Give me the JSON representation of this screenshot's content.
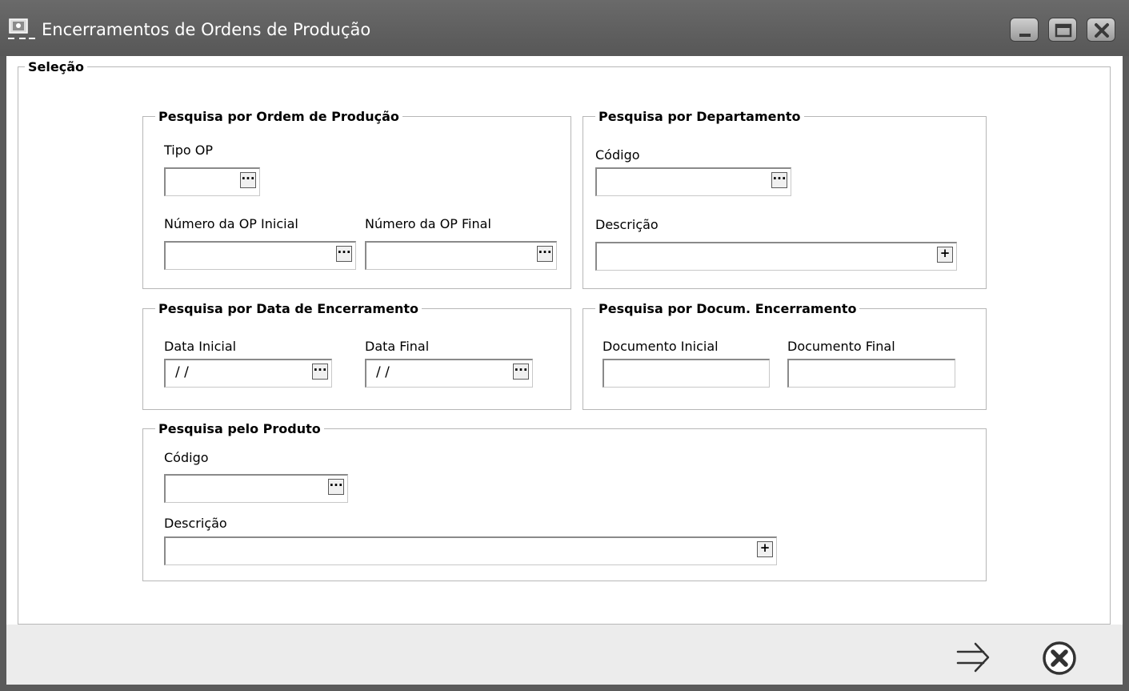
{
  "window": {
    "title": "Encerramentos de Ordens de Produção",
    "icon": "app-icon"
  },
  "selecao": {
    "legend": "Seleção"
  },
  "ordem": {
    "legend": "Pesquisa por Ordem de Produção",
    "tipo_label": "Tipo OP",
    "tipo_value": "",
    "inicial_label": "Número da OP Inicial",
    "inicial_value": "",
    "final_label": "Número da OP Final",
    "final_value": ""
  },
  "departamento": {
    "legend": "Pesquisa por Departamento",
    "codigo_label": "Código",
    "codigo_value": "",
    "descricao_label": "Descrição",
    "descricao_value": ""
  },
  "data_enc": {
    "legend": "Pesquisa por Data de Encerramento",
    "inicial_label": "Data Inicial",
    "inicial_value": "/ /",
    "final_label": "Data Final",
    "final_value": "/ /"
  },
  "documento": {
    "legend": "Pesquisa por Docum. Encerramento",
    "inicial_label": "Documento Inicial",
    "inicial_value": "",
    "final_label": "Documento Final",
    "final_value": ""
  },
  "produto": {
    "legend": "Pesquisa pelo Produto",
    "codigo_label": "Código",
    "codigo_value": "",
    "descricao_label": "Descrição",
    "descricao_value": ""
  },
  "buttons": {
    "lookup_glyph": "···",
    "add_glyph": "+",
    "confirm_icon": "arrow-right-icon",
    "cancel_icon": "close-circle-icon"
  },
  "colors": {
    "titlebar": "#5f5f5f",
    "footer": "#ececec",
    "border": "#b7b7b7"
  }
}
